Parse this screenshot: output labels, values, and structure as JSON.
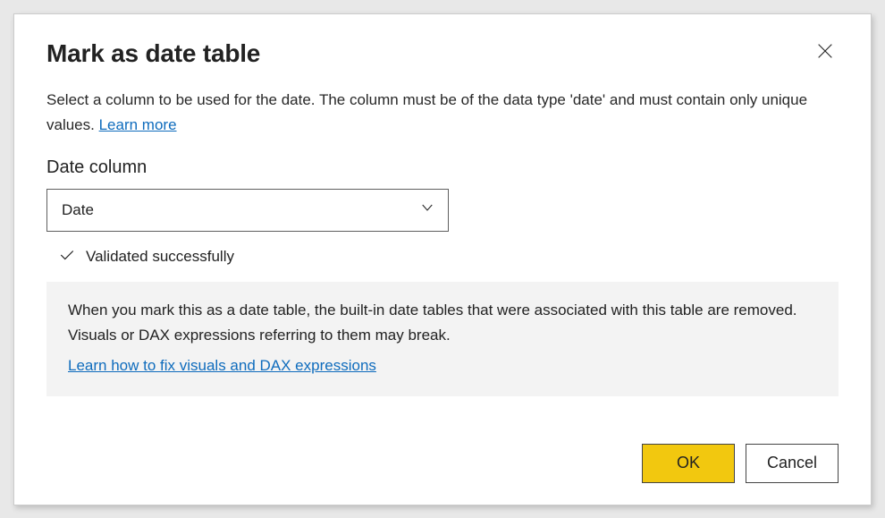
{
  "dialog": {
    "title": "Mark as date table",
    "description_text": "Select a column to be used for the date. The column must be of the data type 'date' and must contain only unique values. ",
    "learn_more_label": "Learn more"
  },
  "field": {
    "label": "Date column",
    "selected_value": "Date"
  },
  "validation": {
    "message": "Validated successfully"
  },
  "info": {
    "text": "When you mark this as a date table, the built-in date tables that were associated with this table are removed. Visuals or DAX expressions referring to them may break.",
    "link_label": "Learn how to fix visuals and DAX expressions"
  },
  "footer": {
    "ok_label": "OK",
    "cancel_label": "Cancel"
  }
}
